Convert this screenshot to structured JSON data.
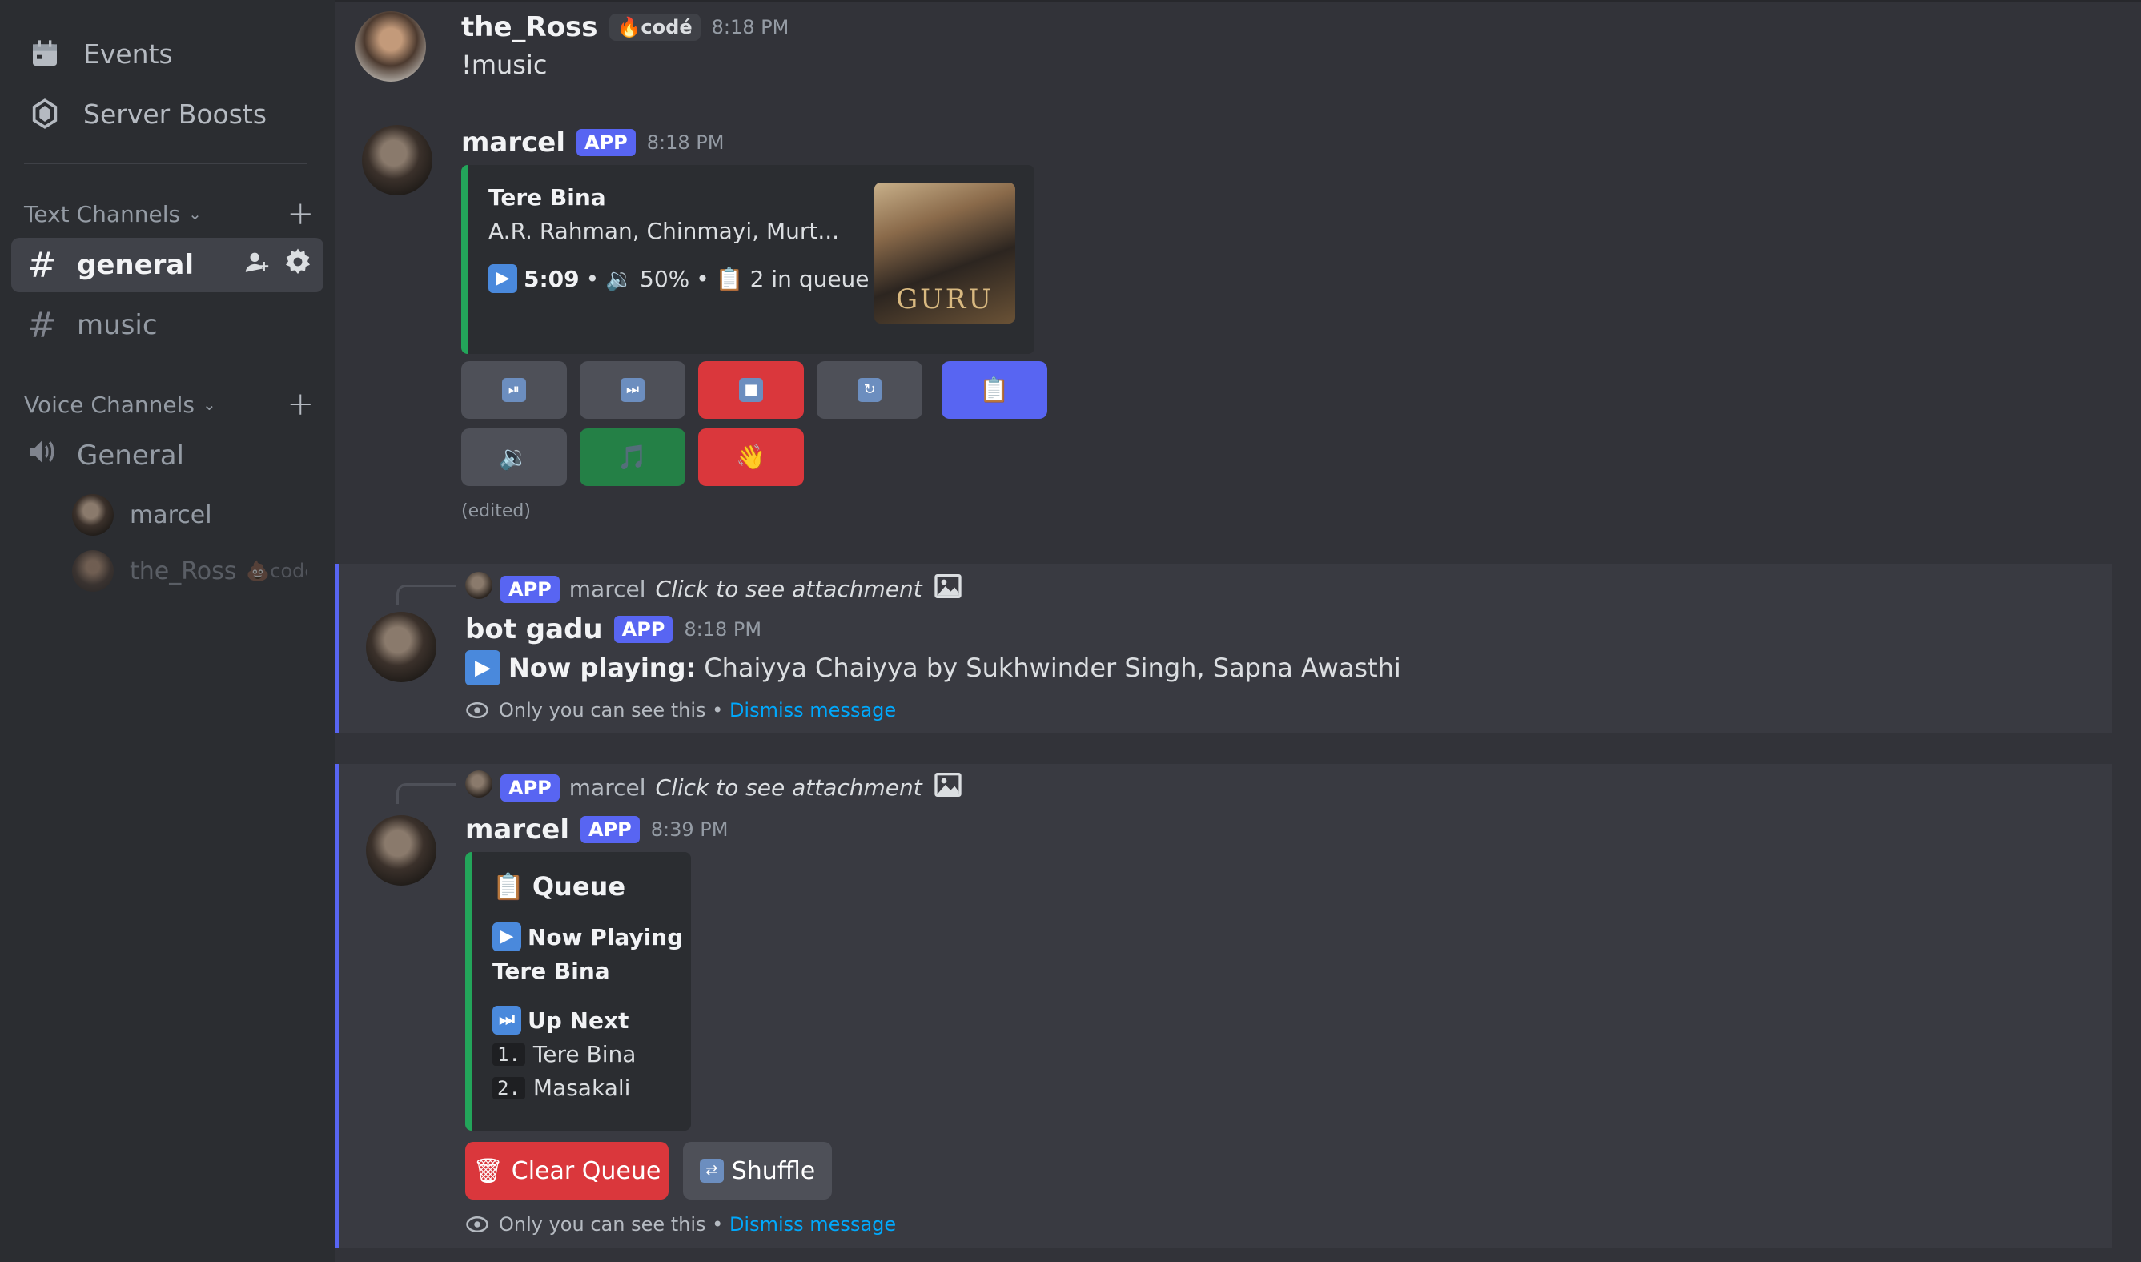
{
  "sidebar": {
    "events_label": "Events",
    "boosts_label": "Server Boosts",
    "text_category": "Text Channels",
    "voice_category": "Voice Channels",
    "text_channels": [
      {
        "name": "general",
        "active": true
      },
      {
        "name": "music",
        "active": false
      }
    ],
    "voice_channel": "General",
    "voice_users": [
      {
        "name": "marcel"
      },
      {
        "name": "the_Ross",
        "badge": "codé"
      }
    ]
  },
  "messages": {
    "m1": {
      "author": "the_Ross",
      "role_badge": "codé",
      "time": "8:18 PM",
      "text": "!music"
    },
    "m2": {
      "author": "marcel",
      "app_badge": "APP",
      "time": "8:18 PM",
      "embed": {
        "title": "Tere Bina",
        "artist": "A.R. Rahman, Chinmayi, Murt...",
        "duration": "5:09",
        "volume": "50%",
        "queue": "2 in queue",
        "album_text": "GURU"
      },
      "edited": "(edited)"
    },
    "m3": {
      "reply_badge": "APP",
      "reply_author": "marcel",
      "reply_text": "Click to see attachment",
      "author": "bot gadu",
      "app_badge": "APP",
      "time": "8:18 PM",
      "bold": "Now playing:",
      "text": "Chaiyya Chaiyya by Sukhwinder Singh, Sapna Awasthi",
      "note": "Only you can see this •",
      "dismiss": "Dismiss message"
    },
    "m4": {
      "reply_badge": "APP",
      "reply_author": "marcel",
      "reply_text": "Click to see attachment",
      "author": "marcel",
      "app_badge": "APP",
      "time": "8:39 PM",
      "embed": {
        "title": "Queue",
        "now_playing_label": "Now Playing",
        "now_playing_track": "Tere Bina",
        "up_next_label": "Up Next",
        "items": [
          {
            "num": "1.",
            "name": "Tere Bina"
          },
          {
            "num": "2.",
            "name": "Masakali"
          }
        ]
      },
      "clear_label": "Clear Queue",
      "shuffle_label": "Shuffle",
      "note": "Only you can see this •",
      "dismiss": "Dismiss message"
    }
  },
  "colors": {
    "accent": "#5865f2",
    "embed_border": "#23a55a",
    "danger": "#da373c",
    "success": "#248046",
    "link": "#00a8fc"
  }
}
